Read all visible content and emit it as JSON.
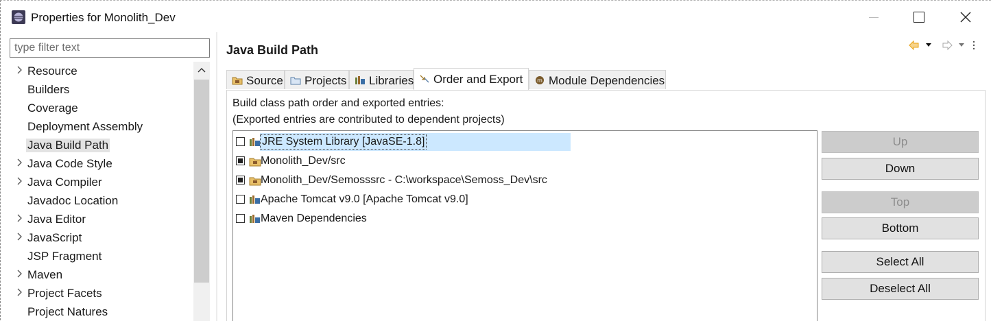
{
  "window": {
    "title": "Properties for Monolith_Dev"
  },
  "sidebar": {
    "filter_placeholder": "type filter text",
    "items": [
      {
        "label": "Resource",
        "expandable": true
      },
      {
        "label": "Builders",
        "expandable": false
      },
      {
        "label": "Coverage",
        "expandable": false
      },
      {
        "label": "Deployment Assembly",
        "expandable": false
      },
      {
        "label": "Java Build Path",
        "expandable": false,
        "selected": true
      },
      {
        "label": "Java Code Style",
        "expandable": true
      },
      {
        "label": "Java Compiler",
        "expandable": true
      },
      {
        "label": "Javadoc Location",
        "expandable": false
      },
      {
        "label": "Java Editor",
        "expandable": true
      },
      {
        "label": "JavaScript",
        "expandable": true
      },
      {
        "label": "JSP Fragment",
        "expandable": false
      },
      {
        "label": "Maven",
        "expandable": true
      },
      {
        "label": "Project Facets",
        "expandable": true
      },
      {
        "label": "Project Natures",
        "expandable": false
      }
    ]
  },
  "main": {
    "title": "Java Build Path",
    "tabs": [
      {
        "label": "Source",
        "icon": "source-folder-icon"
      },
      {
        "label": "Projects",
        "icon": "projects-icon"
      },
      {
        "label": "Libraries",
        "icon": "libraries-icon"
      },
      {
        "label": "Order and Export",
        "icon": "order-export-icon",
        "active": true
      },
      {
        "label": "Module Dependencies",
        "icon": "module-icon"
      }
    ],
    "description_line1": "Build class path order and exported entries:",
    "description_line2": "(Exported entries are contributed to dependent projects)",
    "entries": [
      {
        "label": "JRE System Library [JavaSE-1.8]",
        "checked": false,
        "icon": "library-icon",
        "selected": true
      },
      {
        "label": "Monolith_Dev/src",
        "checked": true,
        "icon": "package-folder-icon"
      },
      {
        "label": "Monolith_Dev/Semosssrc - C:\\workspace\\Semoss_Dev\\src",
        "checked": true,
        "icon": "package-folder-icon"
      },
      {
        "label": "Apache Tomcat v9.0 [Apache Tomcat v9.0]",
        "checked": false,
        "icon": "library-icon"
      },
      {
        "label": "Maven Dependencies",
        "checked": false,
        "icon": "library-icon"
      }
    ],
    "buttons": {
      "up": "Up",
      "down": "Down",
      "top": "Top",
      "bottom": "Bottom",
      "select_all": "Select All",
      "deselect_all": "Deselect All"
    }
  },
  "colors": {
    "selection": "#cce8ff",
    "nav_back_arrow": "#e8a317",
    "button_face": "#e1e1e1",
    "disabled_button": "#cccccc"
  }
}
